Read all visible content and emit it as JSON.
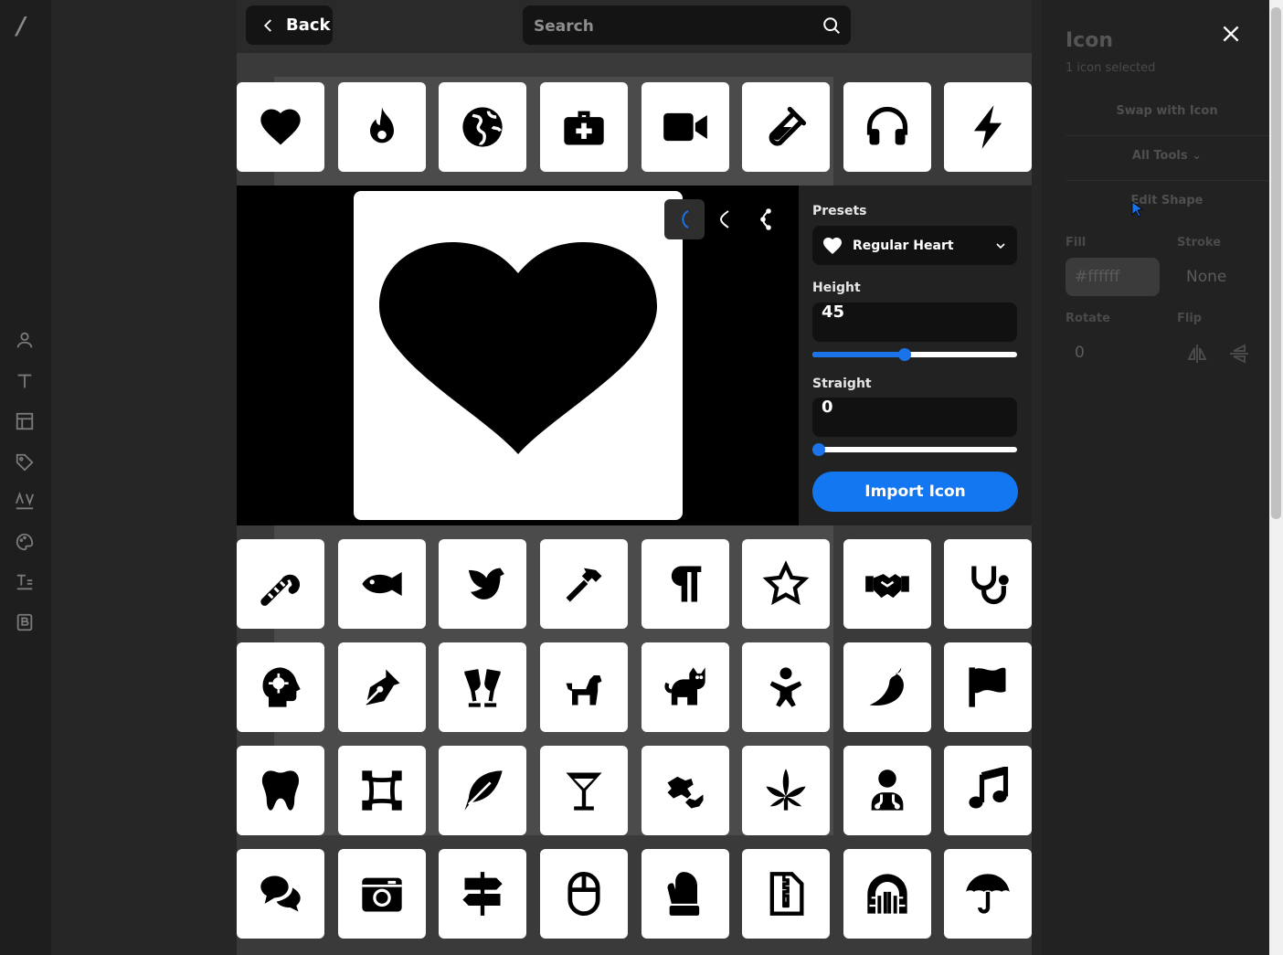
{
  "left_rail": {
    "logo": "/",
    "icons": [
      "user-icon",
      "text-icon",
      "layout-icon",
      "tag-icon",
      "kerning-icon",
      "palette-icon",
      "text-style-icon",
      "brand-icon"
    ]
  },
  "right_panel": {
    "title": "Icon",
    "subtitle": "1 icon selected",
    "swap_label": "Swap with Icon",
    "tools_label": "All Tools",
    "edit_shape_label": "Edit Shape",
    "fill_label": "Fill",
    "stroke_label": "Stroke",
    "fill_value": "#ffffff",
    "stroke_value": "None",
    "rotate_label": "Rotate",
    "flip_label": "Flip",
    "rotate_value": "0"
  },
  "top_bar": {
    "back_label": "Back",
    "search_placeholder": "Search"
  },
  "icons_row1": [
    "heart-icon",
    "fire-icon",
    "globe-icon",
    "medkit-icon",
    "video-camera-icon",
    "test-tube-icon",
    "headphones-icon",
    "lightning-icon"
  ],
  "icons_grid": [
    [
      "candy-cane-icon",
      "fish-icon",
      "dove-icon",
      "hammer-icon",
      "paragraph-icon",
      "star-icon",
      "handshake-icon",
      "stethoscope-icon"
    ],
    [
      "head-virus-icon",
      "pen-nib-icon",
      "champagne-glasses-icon",
      "dog-icon",
      "cat-icon",
      "baby-icon",
      "pepper-icon",
      "flag-icon"
    ],
    [
      "tooth-icon",
      "vector-square-icon",
      "feather-icon",
      "martini-glass-icon",
      "hands-asl-icon",
      "cannabis-leaf-icon",
      "doctor-icon",
      "music-note-icon"
    ],
    [
      "comments-icon",
      "camera-retro-icon",
      "signs-post-icon",
      "computer-mouse-icon",
      "mitten-icon",
      "zip-file-icon",
      "dungeon-icon",
      "umbrella-icon"
    ]
  ],
  "editor": {
    "presets_label": "Presets",
    "preset_value": "Regular Heart",
    "height_label": "Height",
    "height_value": "45",
    "height_fraction": 0.45,
    "straight_label": "Straight",
    "straight_value": "0",
    "straight_fraction": 0.0,
    "import_label": "Import Icon",
    "node_tools": [
      "curve-node-icon",
      "corner-node-icon",
      "asymmetric-node-icon"
    ]
  },
  "colors": {
    "accent": "#1477f2",
    "slider": "#1a73e8"
  }
}
